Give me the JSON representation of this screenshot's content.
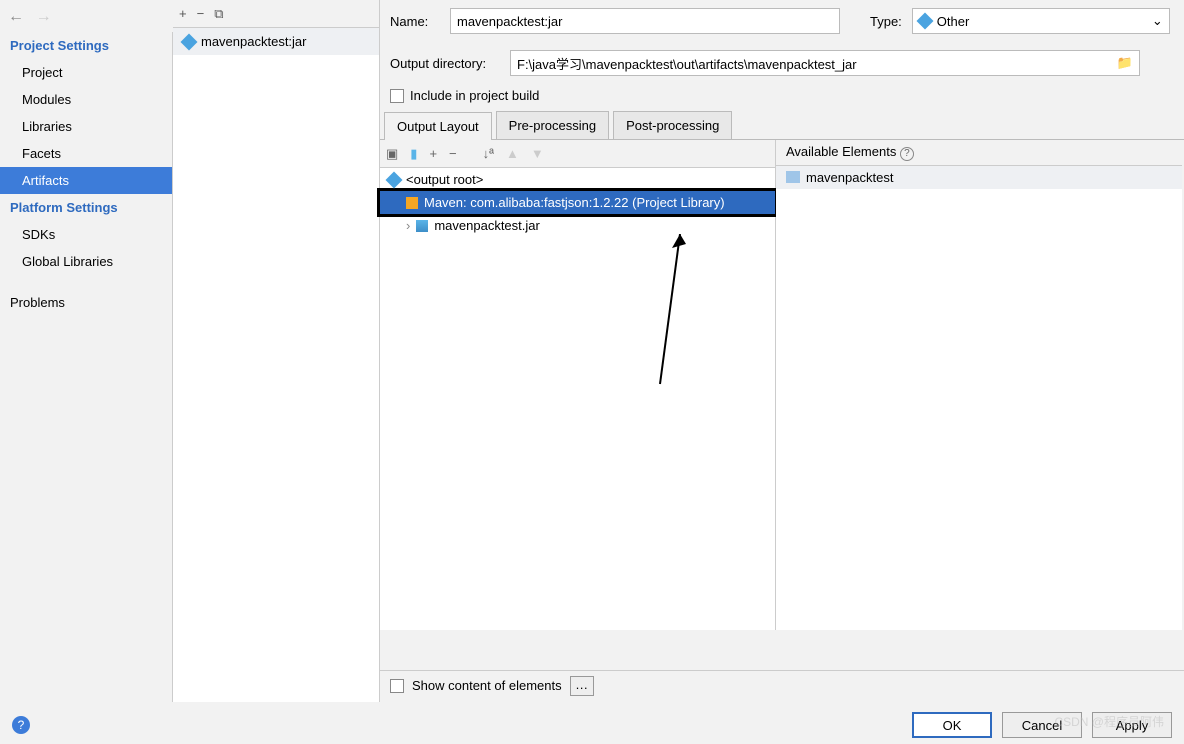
{
  "sidebar": {
    "section1": "Project Settings",
    "items1": [
      "Project",
      "Modules",
      "Libraries",
      "Facets",
      "Artifacts"
    ],
    "selected1": "Artifacts",
    "section2": "Platform Settings",
    "items2": [
      "SDKs",
      "Global Libraries"
    ],
    "section3": "Problems"
  },
  "artifacts_list": {
    "item": "mavenpacktest:jar"
  },
  "form": {
    "name_label": "Name:",
    "name_value": "mavenpacktest:jar",
    "type_label": "Type:",
    "type_value": "Other",
    "outdir_label": "Output directory:",
    "outdir_value": "F:\\java学习\\mavenpacktest\\out\\artifacts\\mavenpacktest_jar",
    "include_label": "Include in project build"
  },
  "tabs": [
    "Output Layout",
    "Pre-processing",
    "Post-processing"
  ],
  "tree": {
    "root": "<output root>",
    "lib": "Maven: com.alibaba:fastjson:1.2.22 (Project Library)",
    "jar": "mavenpacktest.jar"
  },
  "available": {
    "header": "Available Elements",
    "item": "mavenpacktest"
  },
  "bottom": {
    "show_label": "Show content of elements"
  },
  "buttons": {
    "ok": "OK",
    "cancel": "Cancel",
    "apply": "Apply"
  },
  "watermark": "CSDN @程序员阿伟"
}
